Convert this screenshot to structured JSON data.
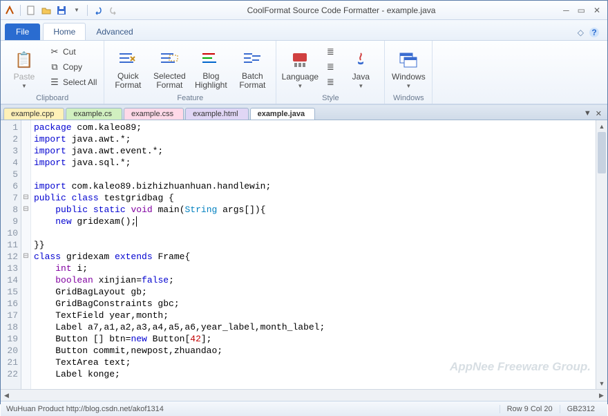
{
  "title": "CoolFormat Source Code Formatter - example.java",
  "menutabs": {
    "file": "File",
    "home": "Home",
    "advanced": "Advanced"
  },
  "ribbon": {
    "clipboard": {
      "label": "Clipboard",
      "paste": "Paste",
      "cut": "Cut",
      "copy": "Copy",
      "selectall": "Select All"
    },
    "feature": {
      "label": "Feature",
      "quick": "Quick Format",
      "selected": "Selected Format",
      "blog": "Blog Highlight",
      "batch": "Batch Format"
    },
    "style": {
      "label": "Style",
      "language": "Language",
      "java": "Java"
    },
    "windows": {
      "label": "Windows",
      "windows": "Windows"
    }
  },
  "doctabs": [
    {
      "label": "example.cpp",
      "color": "#fff1b8"
    },
    {
      "label": "example.cs",
      "color": "#d1f0c0"
    },
    {
      "label": "example.css",
      "color": "#ffd9e8"
    },
    {
      "label": "example.html",
      "color": "#e0d6f5"
    },
    {
      "label": "example.java",
      "color": "#ffffff",
      "active": true
    }
  ],
  "lines": [
    {
      "n": 1,
      "html": "<span class='kw'>package</span> com.kaleo89;"
    },
    {
      "n": 2,
      "html": "<span class='kw'>import</span> java.awt.*;"
    },
    {
      "n": 3,
      "html": "<span class='kw'>import</span> java.awt.event.*;"
    },
    {
      "n": 4,
      "html": "<span class='kw'>import</span> java.sql.*;"
    },
    {
      "n": 5,
      "html": ""
    },
    {
      "n": 6,
      "html": "<span class='kw'>import</span> com.kaleo89.bizhizhuanhuan.handlewin;"
    },
    {
      "n": 7,
      "fold": "⊟",
      "html": "<span class='kw'>public</span> <span class='kw'>class</span> testgridbag {"
    },
    {
      "n": 8,
      "fold": "⊟",
      "html": "    <span class='kw'>public</span> <span class='kw'>static</span> <span class='kw2'>void</span> main(<span class='type'>String</span> args[]){"
    },
    {
      "n": 9,
      "html": "    <span class='kw'>new</span> gridexam();<span class='cursor'></span>"
    },
    {
      "n": 10,
      "html": ""
    },
    {
      "n": 11,
      "html": "}}"
    },
    {
      "n": 12,
      "fold": "⊟",
      "html": "<span class='kw'>class</span> gridexam <span class='kw'>extends</span> Frame{"
    },
    {
      "n": 13,
      "html": "    <span class='kw2'>int</span> i;"
    },
    {
      "n": 14,
      "html": "    <span class='kw2'>boolean</span> xinjian=<span class='kw'>false</span>;"
    },
    {
      "n": 15,
      "html": "    GridBagLayout gb;"
    },
    {
      "n": 16,
      "html": "    GridBagConstraints gbc;"
    },
    {
      "n": 17,
      "html": "    TextField year,month;"
    },
    {
      "n": 18,
      "html": "    Label a7,a1,a2,a3,a4,a5,a6,year_label,month_label;"
    },
    {
      "n": 19,
      "html": "    Button [] btn=<span class='kw'>new</span> Button[<span class='num'>42</span>];"
    },
    {
      "n": 20,
      "html": "    Button commit,newpost,zhuandao;"
    },
    {
      "n": 21,
      "html": "    TextArea text;"
    },
    {
      "n": 22,
      "html": "    Label konge;"
    }
  ],
  "status": {
    "product": "WuHuan Product http://blog.csdn.net/akof1314",
    "pos": "Row 9   Col 20",
    "enc": "GB2312"
  },
  "watermark": "AppNee Freeware Group."
}
